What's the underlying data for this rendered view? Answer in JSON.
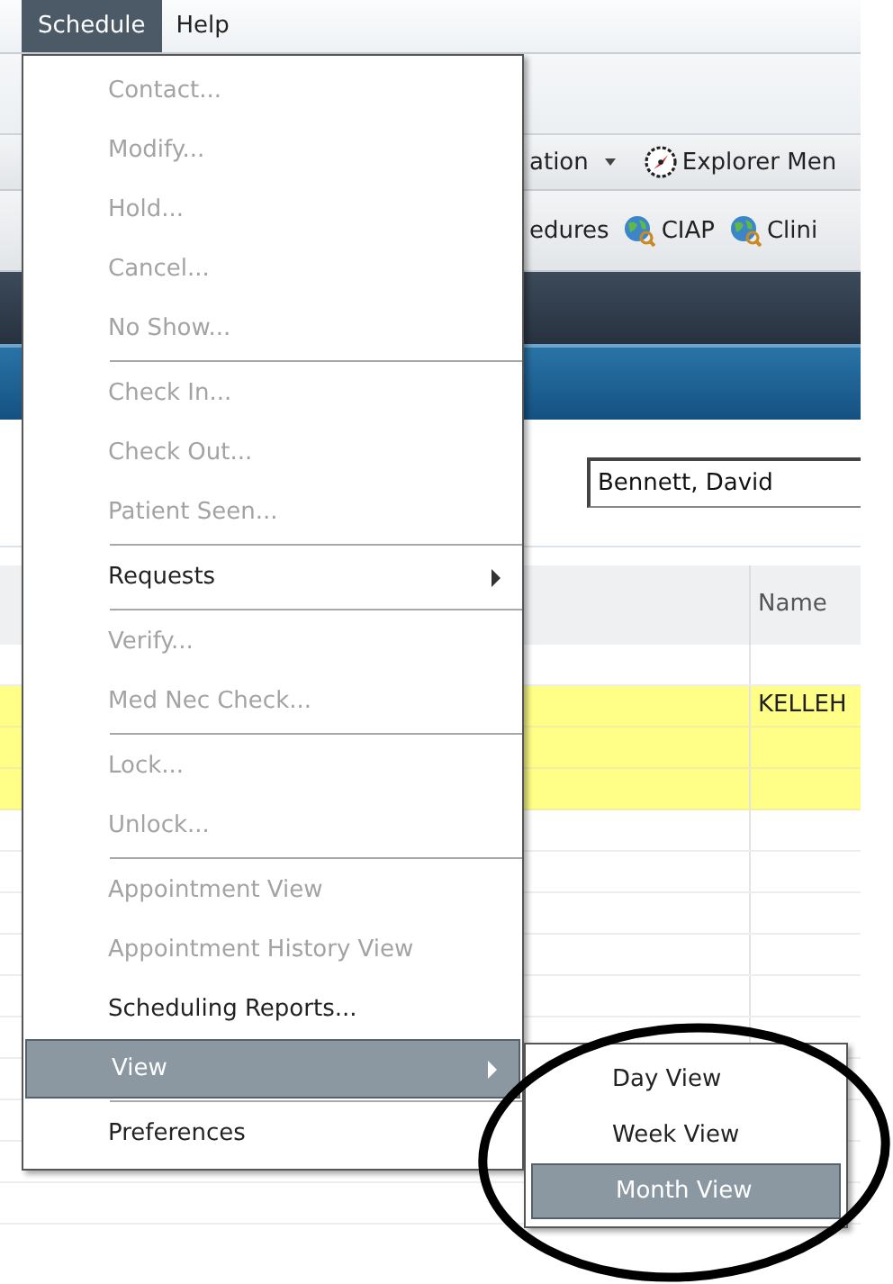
{
  "menubar": [
    {
      "label": "Schedule",
      "selected": true
    },
    {
      "label": "Help",
      "selected": false
    }
  ],
  "toolbar_1": [
    {
      "label": "ation",
      "kind": "dropdown"
    },
    {
      "label": "Explorer Men",
      "kind": "compass"
    }
  ],
  "toolbar_2": [
    {
      "label": "edures",
      "kind": "text"
    },
    {
      "label": "CIAP",
      "kind": "globe"
    },
    {
      "label": "Clini",
      "kind": "globe"
    }
  ],
  "patient_field": {
    "value": "Bennett, David"
  },
  "grid": {
    "columns": [
      "Name"
    ],
    "rows": [
      {
        "highlighted": false
      },
      {
        "highlighted": true,
        "name": "KELLEH"
      },
      {
        "highlighted": true
      },
      {
        "highlighted": true
      },
      {
        "highlighted": false
      },
      {
        "highlighted": false
      },
      {
        "highlighted": false
      },
      {
        "highlighted": false
      },
      {
        "highlighted": false
      },
      {
        "highlighted": false
      },
      {
        "highlighted": false
      },
      {
        "highlighted": false
      },
      {
        "highlighted": false
      },
      {
        "highlighted": false
      }
    ]
  },
  "menu": {
    "items": [
      {
        "kind": "item",
        "label": "Contact...",
        "disabled": true,
        "selected": false
      },
      {
        "kind": "item",
        "label": "Modify...",
        "disabled": true,
        "selected": false
      },
      {
        "kind": "item",
        "label": "Hold...",
        "disabled": true,
        "selected": false
      },
      {
        "kind": "item",
        "label": "Cancel...",
        "disabled": true,
        "selected": false
      },
      {
        "kind": "item",
        "label": "No Show...",
        "disabled": true,
        "selected": false
      },
      {
        "kind": "separator"
      },
      {
        "kind": "item",
        "label": "Check In...",
        "disabled": true,
        "selected": false
      },
      {
        "kind": "item",
        "label": "Check Out...",
        "disabled": true,
        "selected": false
      },
      {
        "kind": "item",
        "label": "Patient Seen...",
        "disabled": true,
        "selected": false
      },
      {
        "kind": "separator"
      },
      {
        "kind": "submenu",
        "label": "Requests",
        "disabled": false,
        "selected": false
      },
      {
        "kind": "separator"
      },
      {
        "kind": "item",
        "label": "Verify...",
        "disabled": true,
        "selected": false
      },
      {
        "kind": "item",
        "label": "Med Nec Check...",
        "disabled": true,
        "selected": false
      },
      {
        "kind": "separator"
      },
      {
        "kind": "item",
        "label": "Lock...",
        "disabled": true,
        "selected": false
      },
      {
        "kind": "item",
        "label": "Unlock...",
        "disabled": true,
        "selected": false
      },
      {
        "kind": "separator"
      },
      {
        "kind": "item",
        "label": "Appointment View",
        "disabled": true,
        "selected": false
      },
      {
        "kind": "item",
        "label": "Appointment History View",
        "disabled": true,
        "selected": false
      },
      {
        "kind": "item",
        "label": "Scheduling Reports...",
        "disabled": false,
        "selected": false
      },
      {
        "kind": "submenu",
        "label": "View",
        "disabled": false,
        "selected": true
      },
      {
        "kind": "separator"
      },
      {
        "kind": "item",
        "label": "Preferences",
        "disabled": false,
        "selected": false
      }
    ]
  },
  "submenu": {
    "items": [
      {
        "label": "Day View",
        "selected": false
      },
      {
        "label": "Week View",
        "selected": false
      },
      {
        "label": "Month View",
        "selected": true
      }
    ]
  },
  "annotation": {
    "kind": "ellipse"
  }
}
